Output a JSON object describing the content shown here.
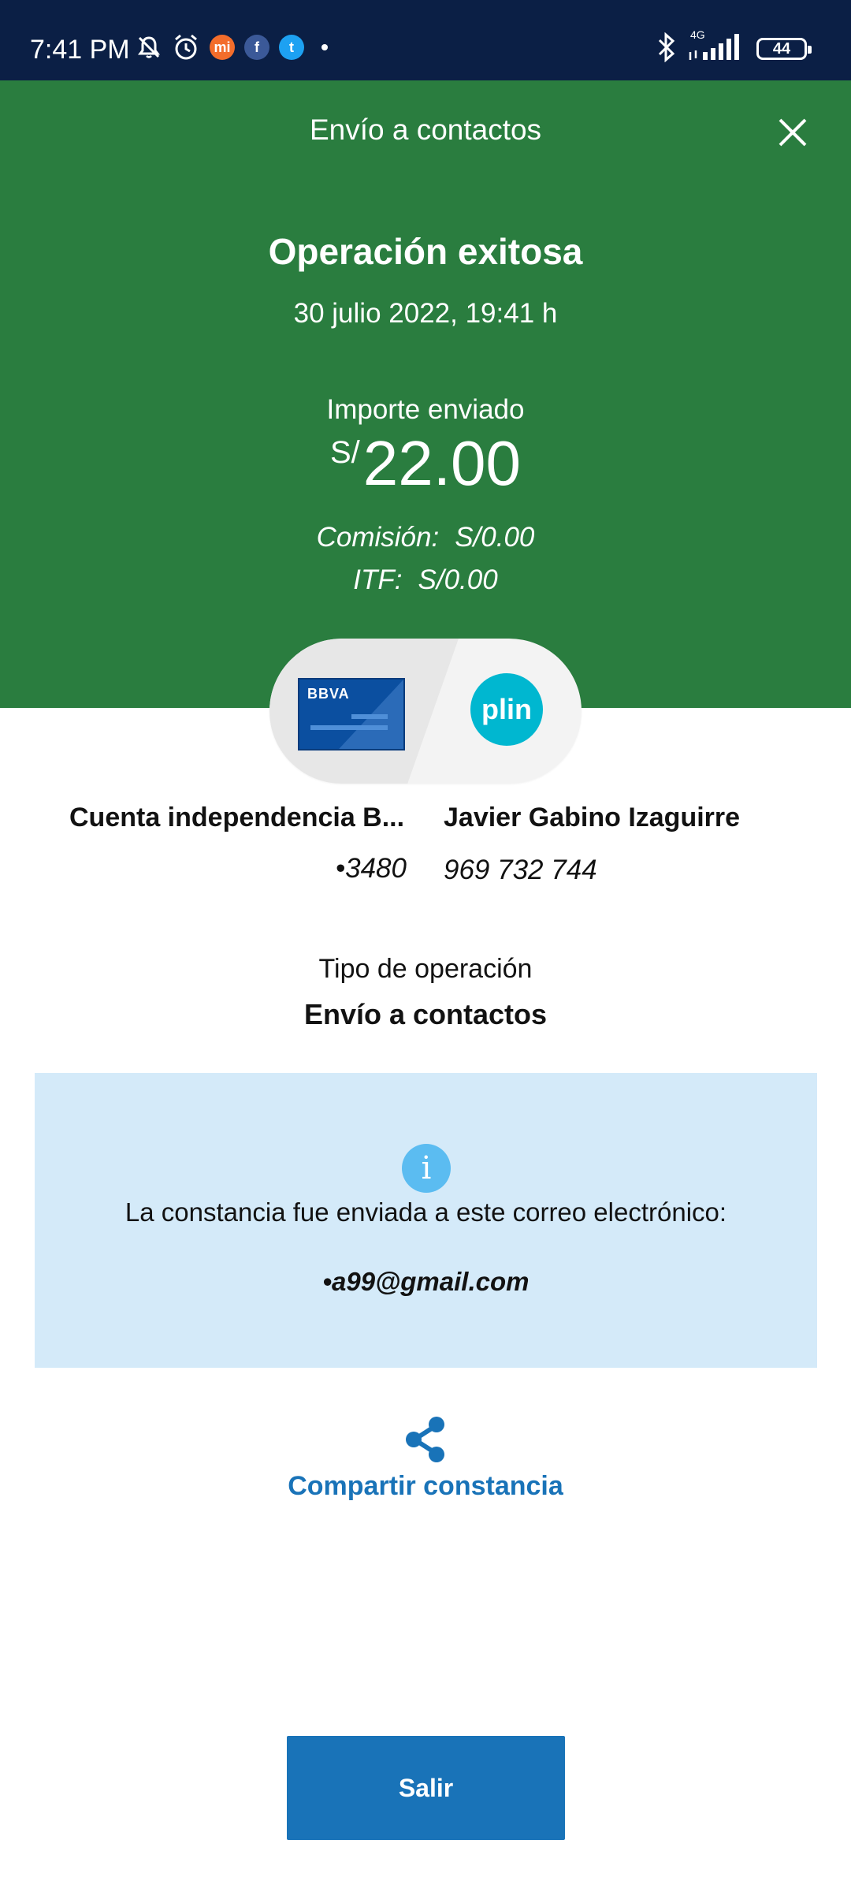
{
  "status_bar": {
    "time": "7:41 PM",
    "battery": "44",
    "network": "4G",
    "icons": [
      "mute-icon",
      "alarm-icon",
      "mi-icon",
      "facebook-icon",
      "twitter-icon",
      "dot-icon",
      "bluetooth-icon",
      "signal-icon",
      "battery-icon"
    ]
  },
  "header": {
    "title": "Envío a contactos",
    "status_title": "Operación exitosa",
    "datetime": "30 julio 2022, 19:41 h",
    "amount_label": "Importe enviado",
    "currency": "S/",
    "amount": "22.00",
    "commission_label": "Comisión:",
    "commission_value": "S/0.00",
    "itf_label": "ITF:",
    "itf_value": "S/0.00",
    "bg_color": "#2a7d3f"
  },
  "origin": {
    "card_logo": "BBVA",
    "account_name": "Cuenta independencia B...",
    "account_number": "•3480"
  },
  "destination": {
    "app_logo": "plin",
    "name": "Javier Gabino Izaguirre",
    "phone": "969 732 744"
  },
  "operation": {
    "label": "Tipo de operación",
    "value": "Envío a contactos"
  },
  "info": {
    "text": "La constancia fue enviada a este correo electrónico:",
    "email": "•a99@gmail.com",
    "bg_color": "#d4eaf9"
  },
  "share": {
    "label": "Compartir constancia"
  },
  "exit_button": {
    "label": "Salir",
    "color": "#1973b8"
  }
}
